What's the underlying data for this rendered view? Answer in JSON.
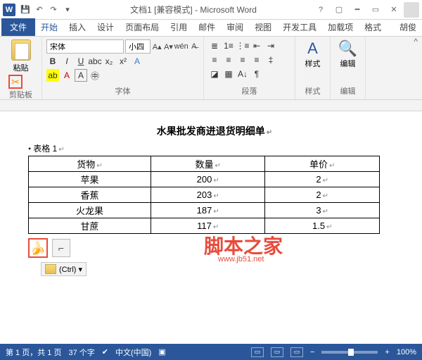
{
  "titlebar": {
    "word_glyph": "W",
    "title": "文档1 [兼容模式] - Microsoft Word"
  },
  "tabs": {
    "file": "文件",
    "items": [
      "开始",
      "插入",
      "设计",
      "页面布局",
      "引用",
      "邮件",
      "审阅",
      "视图",
      "开发工具",
      "加载项",
      "格式"
    ],
    "active_index": 0,
    "user": "胡俊"
  },
  "ribbon": {
    "clipboard": {
      "paste": "粘贴",
      "label": "剪贴板"
    },
    "font": {
      "name": "宋体",
      "size": "小四",
      "label": "字体"
    },
    "paragraph": {
      "label": "段落"
    },
    "styles": {
      "label": "样式",
      "btn": "样式"
    },
    "editing": {
      "label": "编辑",
      "btn": "编辑"
    }
  },
  "document": {
    "title": "水果批发商进退货明细单",
    "caption": "表格 1",
    "headers": [
      "货物",
      "数量",
      "单价"
    ],
    "rows": [
      [
        "苹果",
        "200",
        "2"
      ],
      [
        "香蕉",
        "203",
        "2"
      ],
      [
        "火龙果",
        "187",
        "3"
      ],
      [
        "甘蔗",
        "117",
        "1.5"
      ]
    ],
    "paste_options": "(Ctrl) ▾"
  },
  "watermark": {
    "line1": "脚本之家",
    "line2": "www.jb51.net"
  },
  "statusbar": {
    "page": "第 1 页，共 1 页",
    "words": "37 个字",
    "lang": "中文(中国)",
    "zoom": "100%",
    "zoom_plus": "+",
    "zoom_minus": "−"
  }
}
